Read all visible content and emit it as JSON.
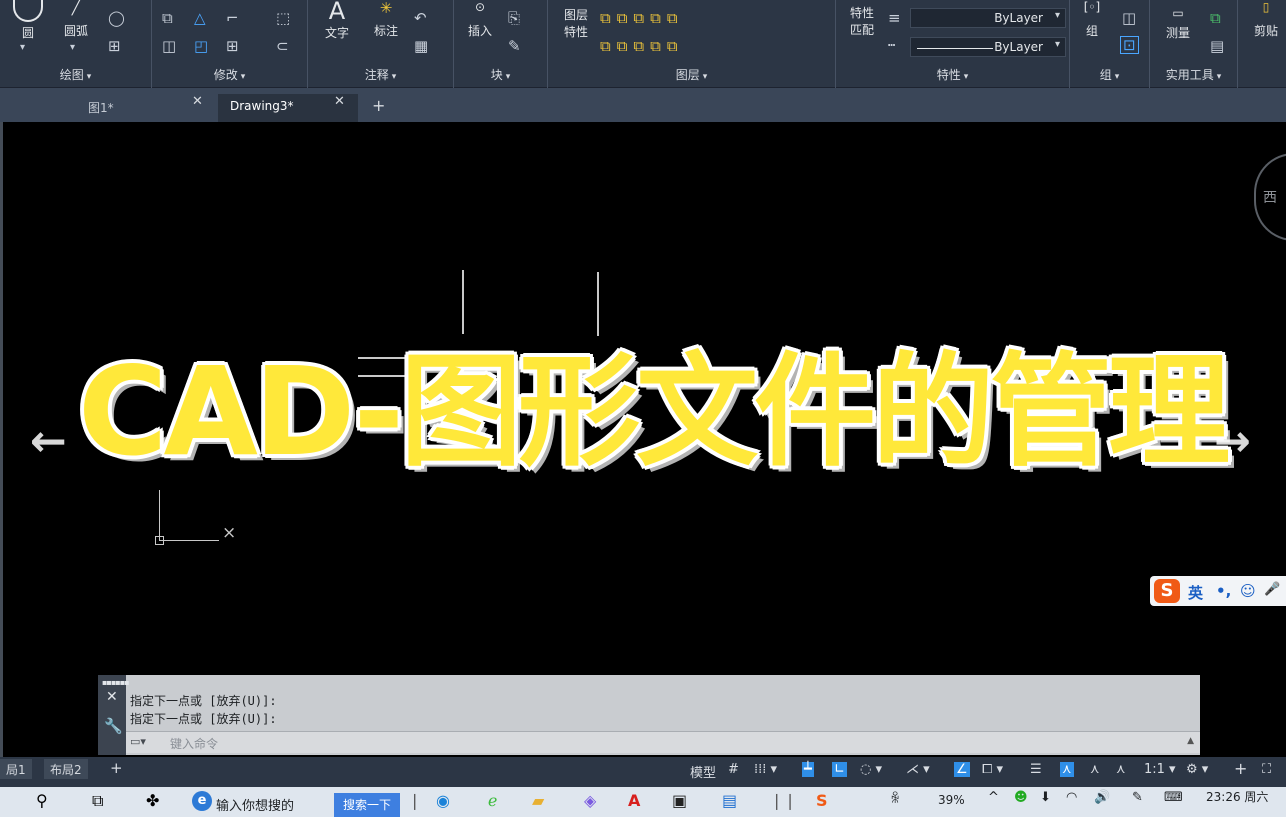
{
  "ribbon": {
    "draw": {
      "circle_label": "圆",
      "arc_label": "圆弧",
      "title": "绘图"
    },
    "modify": {
      "title": "修改"
    },
    "annotation": {
      "text_label": "文字",
      "dim_label": "标注",
      "title": "注释"
    },
    "block": {
      "insert_label": "插入",
      "title": "块"
    },
    "layers": {
      "props_label_1": "图层",
      "props_label_2": "特性",
      "title": "图层"
    },
    "properties": {
      "match_label_1": "特性",
      "match_label_2": "匹配",
      "color_value": "ByLayer",
      "linetype_value": "ByLayer",
      "title": "特性"
    },
    "groups": {
      "group_label": "组",
      "title": "组"
    },
    "utilities": {
      "measure_label": "测量",
      "title": "实用工具"
    },
    "clipboard": {
      "paste_label": "剪贴"
    }
  },
  "tabs": [
    {
      "label": "图1*"
    },
    {
      "label": "Drawing3*"
    }
  ],
  "canvas": {
    "overlay_title": "CAD-图形文件的管理",
    "viewcube_label": "西",
    "prev_arrow": "←",
    "next_arrow": "→",
    "ucs_x_label": "×"
  },
  "ime": {
    "logo": "S",
    "lang": "英",
    "punct": "•,",
    "emoji": "☺",
    "mic": "🎤"
  },
  "command": {
    "history": [
      "指定下一点或 [放弃(U)]:",
      "指定下一点或 [放弃(U)]:"
    ],
    "placeholder": "键入命令"
  },
  "status": {
    "layout_tabs": [
      "局1",
      "布局2"
    ],
    "model_label": "模型",
    "scale_label": "1:1"
  },
  "taskbar": {
    "search_placeholder": "输入你想搜的",
    "search_button": "搜索一下",
    "battery": "39%",
    "time": "23:26",
    "day": "周六"
  }
}
